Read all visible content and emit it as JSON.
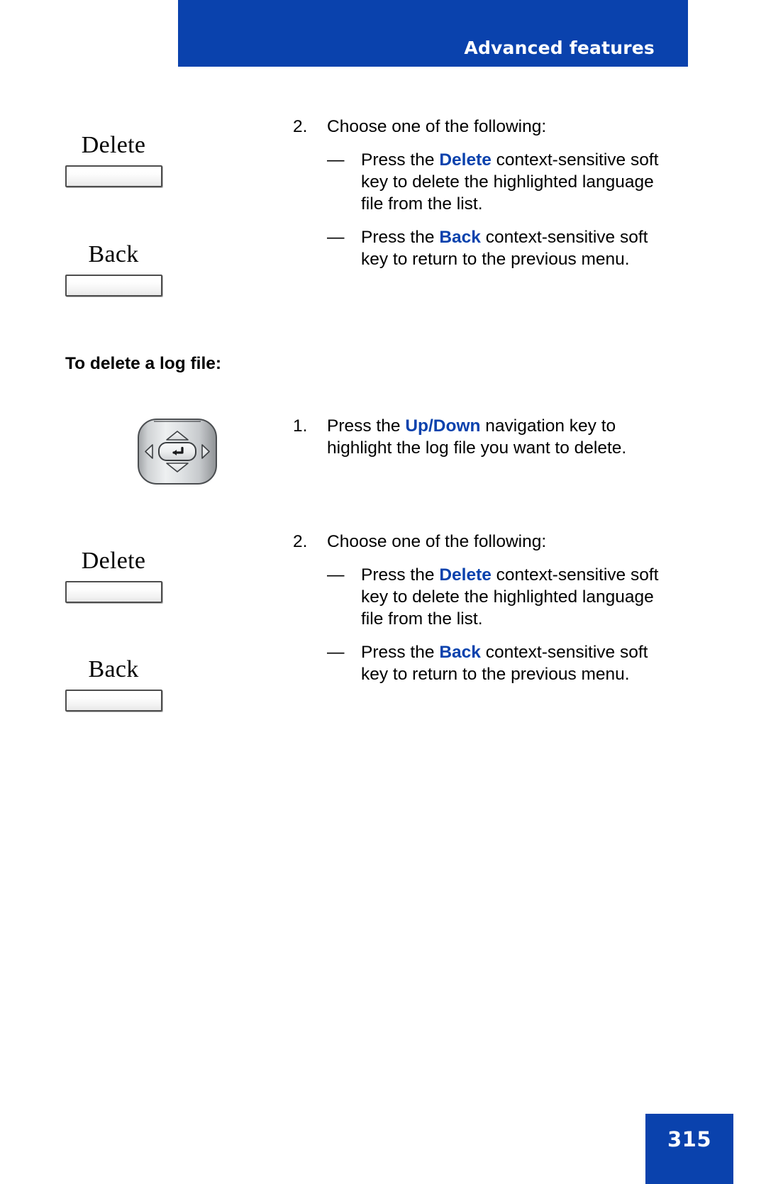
{
  "header": {
    "title": "Advanced features",
    "banner_color": "#0a42ad"
  },
  "accent_color": "#0a42ad",
  "blocks": [
    {
      "id": "block-1",
      "softkeys": [
        {
          "label": "Delete",
          "name": "softkey-delete"
        },
        {
          "label": "Back",
          "name": "softkey-back"
        }
      ],
      "step": {
        "number": "2.",
        "text": "Choose one of the following:",
        "bullets": [
          {
            "dash": "—",
            "lead": "Press the ",
            "keyword": "Delete",
            "tail": " context-sensitive soft key to delete the highlighted language file from the list."
          },
          {
            "dash": "—",
            "lead": "Press the ",
            "keyword": "Back",
            "tail": " context-sensitive soft key to return to the previous menu."
          }
        ]
      }
    }
  ],
  "section": {
    "heading": "To delete a log file:"
  },
  "nav_step": {
    "number": "1.",
    "lead": "Press the ",
    "keyword_up": "Up",
    "separator": "/",
    "keyword_down": "Down",
    "tail": " navigation key to highlight the log file you want to delete.",
    "icon": "navigation-key-icon"
  },
  "block_2": {
    "softkeys": [
      {
        "label": "Delete",
        "name": "softkey-delete"
      },
      {
        "label": "Back",
        "name": "softkey-back"
      }
    ],
    "step": {
      "number": "2.",
      "text": "Choose one of the following:",
      "bullets": [
        {
          "dash": "—",
          "lead": "Press the ",
          "keyword": "Delete",
          "tail": " context-sensitive soft key to delete the highlighted language file from the list."
        },
        {
          "dash": "—",
          "lead": "Press the ",
          "keyword": "Back",
          "tail": " context-sensitive soft key to return to the previous menu."
        }
      ]
    }
  },
  "footer": {
    "page_number": "315"
  }
}
